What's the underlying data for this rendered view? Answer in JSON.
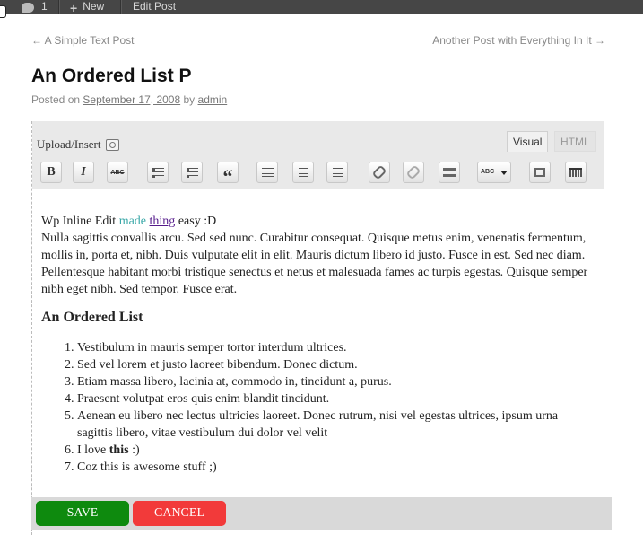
{
  "admin_bar": {
    "comments_count": "1",
    "new_label": "New",
    "edit_label": "Edit Post"
  },
  "post_nav": {
    "prev": "← A Simple Text Post",
    "next": "Another Post with Everything In It →"
  },
  "post": {
    "title": "An Ordered List P",
    "posted_on": "Posted on",
    "date": "September 17, 2008",
    "by": "by",
    "author": "admin"
  },
  "editor": {
    "upload_insert": "Upload/Insert",
    "tab_visual": "Visual",
    "tab_html": "HTML",
    "toolbar": {
      "bold": "B",
      "italic": "I",
      "strike": "ABC",
      "quote": "“",
      "spell": "ABC"
    }
  },
  "content": {
    "intro_part1": "Wp Inline Edit",
    "intro_teal": "made",
    "intro_link": "thing",
    "intro_part2": "easy :D",
    "paragraph": "Nulla sagittis convallis arcu. Sed sed nunc. Curabitur consequat. Quisque metus enim, venenatis fermentum, mollis in, porta et, nibh. Duis vulputate elit in elit. Mauris dictum libero id justo. Fusce in est. Sed nec diam. Pellentesque habitant morbi tristique senectus et netus et malesuada fames ac turpis egestas. Quisque semper nibh eget nibh. Sed tempor. Fusce erat.",
    "heading": "An Ordered List",
    "list": [
      "Vestibulum in mauris semper tortor interdum ultrices.",
      "Sed vel lorem et justo laoreet bibendum. Donec dictum.",
      "Etiam massa libero, lacinia at, commodo in, tincidunt a, purus.",
      "Praesent volutpat eros quis enim blandit tincidunt.",
      "Aenean eu libero nec lectus ultricies laoreet. Donec rutrum, nisi vel egestas ultrices, ipsum urna sagittis libero, vitae vestibulum dui dolor vel velit"
    ],
    "item6_pre": "I love",
    "item6_bold": "this",
    "item6_post": ":)",
    "item7": "Coz this is awesome stuff ;)"
  },
  "actions": {
    "save": "SAVE",
    "cancel": "CANCEL"
  },
  "colors": {
    "save_bg": "#0e8a0e",
    "cancel_bg": "#f23a3a",
    "admin_bar_bg": "#464646",
    "link_teal": "#3aa8a8"
  }
}
